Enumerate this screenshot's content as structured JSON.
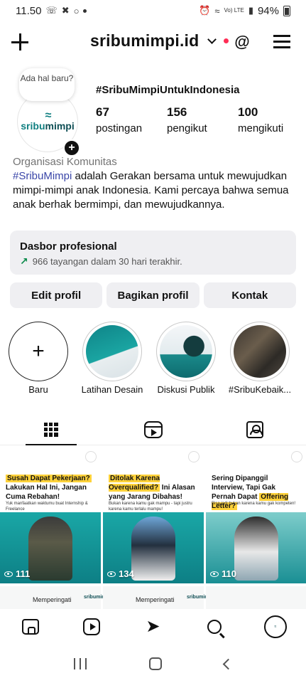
{
  "status_bar": {
    "time": "11.50",
    "battery": "94%",
    "network": "Vo) LTE"
  },
  "header": {
    "username": "sribumimpi.id"
  },
  "note": {
    "text": "Ada hal baru?"
  },
  "avatar": {
    "logo_wave": "≈",
    "logo_prefix": "sribu",
    "logo_suffix": "mimpi"
  },
  "profile": {
    "tagline": "#SribuMimpiUntukIndonesia",
    "stats": [
      {
        "value": "67",
        "label": "postingan"
      },
      {
        "value": "156",
        "label": "pengikut"
      },
      {
        "value": "100",
        "label": "mengikuti"
      }
    ],
    "category": "Organisasi Komunitas",
    "bio_hashtag": "#SribuMimpi",
    "bio_text": " adalah Gerakan bersama untuk mewujudkan mimpi-mimpi anak Indonesia. Kami percaya bahwa semua anak berhak bermimpi, dan mewujudkannya."
  },
  "dashboard": {
    "title": "Dasbor profesional",
    "subtitle": "966 tayangan dalam 30 hari terakhir."
  },
  "actions": {
    "edit": "Edit profil",
    "share": "Bagikan profil",
    "contact": "Kontak"
  },
  "highlights": [
    {
      "label": "Baru"
    },
    {
      "label": "Latihan Desain"
    },
    {
      "label": "Diskusi Publik"
    },
    {
      "label": "#SribuKebaik..."
    }
  ],
  "posts": [
    {
      "head_hl": "Susah Dapat Pekerjaan?",
      "head_rest": "Lakukan Hal Ini, Jangan Cuma Rebahan!",
      "sub": "Yuk manfaatkan waktumu buat Internship & Freelance",
      "views": "111"
    },
    {
      "head_hl": "Ditolak Karena Overqualified?",
      "head_rest": "Ini Alasan yang Jarang Dibahas!",
      "sub": "Bukan karena kamu gak mampu - tapi justru karena kamu terlalu mampu!",
      "views": "134"
    },
    {
      "head_hl": "Sering Dipanggil Interview, Tapi Gak Pernah Dapat",
      "head_rest": "Offering Letter?",
      "sub": "Bisa jadi bukan karena kamu gak kompeten!",
      "views": "110"
    }
  ],
  "posts_row2": [
    {
      "text": "Memperingati",
      "logo": "sribumimpi"
    },
    {
      "text": "Memperingati",
      "logo": "sribumimpi"
    }
  ]
}
